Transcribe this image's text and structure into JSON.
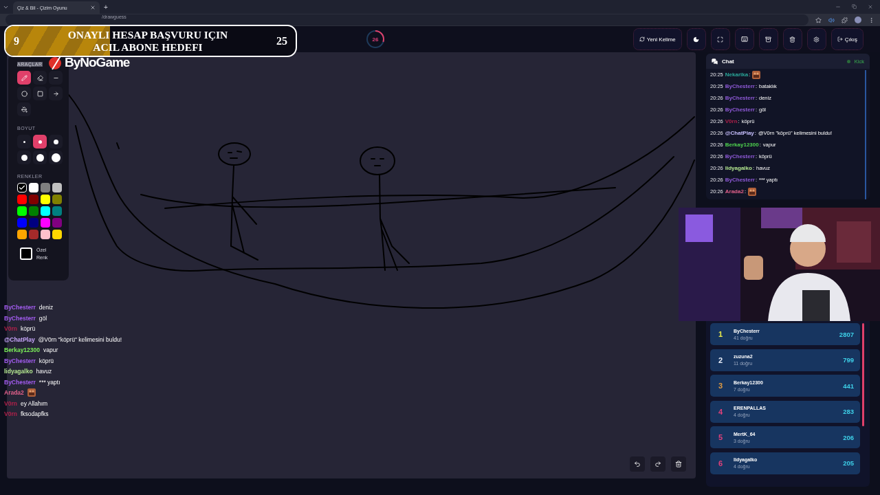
{
  "browser": {
    "tab_title": "Çiz & Bil - Çizim Oyunu",
    "new_tab": "+",
    "url": "/drawguess"
  },
  "goal_banner": {
    "current": "9",
    "title_line_1": "ONAYLI HESAP BAŞVURU IÇIN",
    "title_line_2": "ACIL ABONE HEDEFI",
    "target": "25",
    "level": 0.36
  },
  "timer": {
    "value": "26",
    "level": 0.3
  },
  "header_buttons": [
    {
      "label": "Yeni Kelime"
    },
    {
      "label": "Çıkış"
    }
  ],
  "logo": {
    "text": "ByNoGame"
  },
  "tools": {
    "title": "ARAÇLAR",
    "items": [
      {
        "kind": "pen",
        "selected": true
      },
      {
        "kind": "eraser",
        "selected": false
      },
      {
        "kind": "line",
        "selected": false
      },
      {
        "kind": "circle",
        "selected": false
      },
      {
        "kind": "square",
        "selected": false
      },
      {
        "kind": "arrow",
        "selected": false
      },
      {
        "kind": "fill",
        "selected": false
      }
    ]
  },
  "sizes": {
    "title": "BOYUT",
    "items": [
      {
        "selected": false
      },
      {
        "selected": true
      },
      {
        "selected": false
      },
      {
        "selected": false
      },
      {
        "selected": false
      },
      {
        "selected": false
      }
    ]
  },
  "colors": {
    "title": "RENKLER",
    "items": [
      {
        "color": "#000000",
        "selected": true
      },
      {
        "color": "#ffffff",
        "selected": false
      },
      {
        "color": "#808080",
        "selected": false
      },
      {
        "color": "#c0c0c0",
        "selected": false
      },
      {
        "color": "#ff0000",
        "selected": false
      },
      {
        "color": "#800000",
        "selected": false
      },
      {
        "color": "#ffff00",
        "selected": false
      },
      {
        "color": "#808000",
        "selected": false
      },
      {
        "color": "#00ff00",
        "selected": false
      },
      {
        "color": "#008000",
        "selected": false
      },
      {
        "color": "#00ffff",
        "selected": false
      },
      {
        "color": "#008080",
        "selected": false
      },
      {
        "color": "#0000ff",
        "selected": false
      },
      {
        "color": "#000080",
        "selected": false
      },
      {
        "color": "#ff00ff",
        "selected": false
      },
      {
        "color": "#800080",
        "selected": false
      },
      {
        "color": "#ffa500",
        "selected": false
      },
      {
        "color": "#a52a2a",
        "selected": false
      },
      {
        "color": "#ffc0cb",
        "selected": false
      },
      {
        "color": "#ffd700",
        "selected": false
      }
    ]
  },
  "custom_color": {
    "label": "Özel Renk",
    "color": "#000000"
  },
  "chat": {
    "title": "Chat",
    "platform": "Kick",
    "messages": [
      {
        "time": "20:25",
        "user": "Nekarika",
        "separator": ":",
        "color": "#2aa89a",
        "kind": "emote"
      },
      {
        "time": "20:25",
        "user": "ByChesterr",
        "separator": ":",
        "color": "#8f5ad8",
        "kind": "text",
        "text": "bataklık"
      },
      {
        "time": "20:26",
        "user": "ByChesterr",
        "separator": ":",
        "color": "#8f5ad8",
        "kind": "text",
        "text": "deniz"
      },
      {
        "time": "20:26",
        "user": "ByChesterr",
        "separator": ":",
        "color": "#8f5ad8",
        "kind": "text",
        "text": "göl"
      },
      {
        "time": "20:26",
        "user": "V0rn",
        "separator": ":",
        "color": "#b0204a",
        "kind": "text",
        "text": "köprü"
      },
      {
        "time": "20:26",
        "user": "@ChatPlay",
        "separator": ":",
        "color": "#c8c0ff",
        "kind": "text",
        "text": "@V0rn \"köprü\" kelimesini buldu!"
      },
      {
        "time": "20:26",
        "user": "Berkay12300",
        "separator": ":",
        "color": "#4fd44f",
        "kind": "text",
        "text": "vapur"
      },
      {
        "time": "20:26",
        "user": "ByChesterr",
        "separator": ":",
        "color": "#8f5ad8",
        "kind": "text",
        "text": "köprü"
      },
      {
        "time": "20:26",
        "user": "lidyagalko",
        "separator": ":",
        "color": "#b4e890",
        "kind": "text",
        "text": "havuz"
      },
      {
        "time": "20:26",
        "user": "ByChesterr",
        "separator": ":",
        "color": "#8f5ad8",
        "kind": "text",
        "text": "*** yaptı"
      },
      {
        "time": "20:26",
        "user": "Arada2",
        "separator": ":",
        "color": "#e0608a",
        "kind": "emote"
      }
    ]
  },
  "leaderboard": [
    {
      "rank": "1",
      "name": "ByChesterr",
      "correct": "41 doğru",
      "score": "2807",
      "color": "#e8e84a"
    },
    {
      "rank": "2",
      "name": "zuzuna2",
      "correct": "11 doğru",
      "score": "799",
      "color": "#e8eef8"
    },
    {
      "rank": "3",
      "name": "Berkay12300",
      "correct": "7 doğru",
      "score": "441",
      "color": "#e09a40"
    },
    {
      "rank": "4",
      "name": "ERENPALLAS",
      "correct": "4 doğru",
      "score": "283",
      "color": "#e0407a"
    },
    {
      "rank": "5",
      "name": "MertK_64",
      "correct": "3 doğru",
      "score": "206",
      "color": "#e0407a"
    },
    {
      "rank": "6",
      "name": "lidyagalko",
      "correct": "4 doğru",
      "score": "205",
      "color": "#e0407a"
    }
  ],
  "stream_chat": [
    {
      "user": "ByChesterr",
      "color": "#a35cf0",
      "kind": "text",
      "text": "deniz"
    },
    {
      "user": "ByChesterr",
      "color": "#a35cf0",
      "kind": "text",
      "text": "göl"
    },
    {
      "user": "V0rn",
      "color": "#b0204a",
      "kind": "text",
      "text": "köprü"
    },
    {
      "user": "@ChatPlay",
      "color": "#c9a8ff",
      "kind": "text",
      "text": "@V0rn \"köprü\" kelimesini buldu!"
    },
    {
      "user": "Berkay12300",
      "color": "#7cf05a",
      "kind": "text",
      "text": "vapur"
    },
    {
      "user": "ByChesterr",
      "color": "#a35cf0",
      "kind": "text",
      "text": "köprü"
    },
    {
      "user": "lidyagalko",
      "color": "#b4e890",
      "kind": "text",
      "text": "havuz"
    },
    {
      "user": "ByChesterr",
      "color": "#a35cf0",
      "kind": "text",
      "text": "*** yaptı"
    },
    {
      "user": "Arada2",
      "color": "#e0608a",
      "kind": "emote"
    },
    {
      "user": "V0rn",
      "color": "#b0204a",
      "kind": "text",
      "text": "ey Allahım"
    },
    {
      "user": "V0rn",
      "color": "#b0204a",
      "kind": "text",
      "text": "fksodapfks"
    }
  ]
}
